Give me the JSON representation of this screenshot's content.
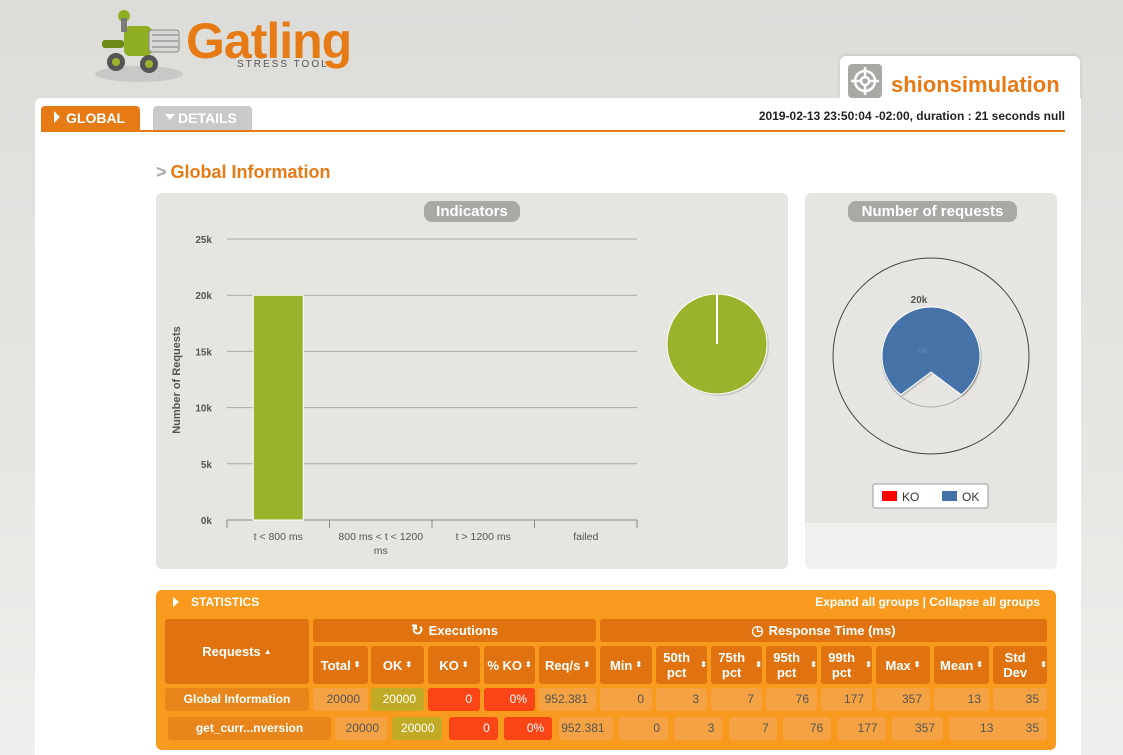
{
  "app": {
    "logo_text": "Gatling",
    "logo_subtitle": "STRESS TOOL",
    "simulation_name": "shionsimulation",
    "run_info": "2019-02-13 23:50:04 -02:00, duration : 21 seconds null"
  },
  "tabs": [
    {
      "label": "GLOBAL",
      "active": true
    },
    {
      "label": "DETAILS",
      "active": false
    }
  ],
  "section": {
    "prefix": ">",
    "title": "Global Information"
  },
  "indicators": {
    "title": "Indicators",
    "chart_data": {
      "type": "bar",
      "categories": [
        "t < 800 ms",
        "800 ms < t < 1200 ms",
        "t > 1200 ms",
        "failed"
      ],
      "values": [
        20000,
        0,
        0,
        0
      ],
      "ylabel": "Number of Requests",
      "ylim": [
        0,
        25000
      ],
      "yticks": [
        "0k",
        "5k",
        "10k",
        "15k",
        "20k",
        "25k"
      ],
      "bar_color": "#9ab32c",
      "grid": true
    },
    "pie": {
      "values": [
        20000,
        0
      ],
      "color": "#9ab32c"
    }
  },
  "number_of_requests": {
    "title": "Number of requests",
    "chart_data": {
      "type": "pie",
      "series": [
        {
          "name": "KO",
          "value": 0,
          "color": "#ff0000"
        },
        {
          "name": "OK",
          "value": 20000,
          "color": "#4572a7"
        }
      ],
      "labels": [
        "20k",
        "0k"
      ]
    },
    "legend": [
      {
        "name": "KO",
        "color": "#ff0000"
      },
      {
        "name": "OK",
        "color": "#4572a7"
      }
    ]
  },
  "statistics": {
    "title": "STATISTICS",
    "expand_label": "Expand all groups",
    "separator": "|",
    "collapse_label": "Collapse all groups",
    "requests_header": "Requests",
    "executions_header": "Executions",
    "response_header": "Response Time (ms)",
    "columns": [
      "Total",
      "OK",
      "KO",
      "% KO",
      "Req/s",
      "Min",
      "50th pct",
      "75th pct",
      "95th pct",
      "99th pct",
      "Max",
      "Mean",
      "Std Dev"
    ],
    "rows": [
      {
        "name": "Global Information",
        "values": [
          "20000",
          "20000",
          "0",
          "0%",
          "952.381",
          "0",
          "3",
          "7",
          "76",
          "177",
          "357",
          "13",
          "35"
        ]
      },
      {
        "name": "get_curr...nversion",
        "values": [
          "20000",
          "20000",
          "0",
          "0%",
          "952.381",
          "0",
          "3",
          "7",
          "76",
          "177",
          "357",
          "13",
          "35"
        ]
      }
    ]
  }
}
